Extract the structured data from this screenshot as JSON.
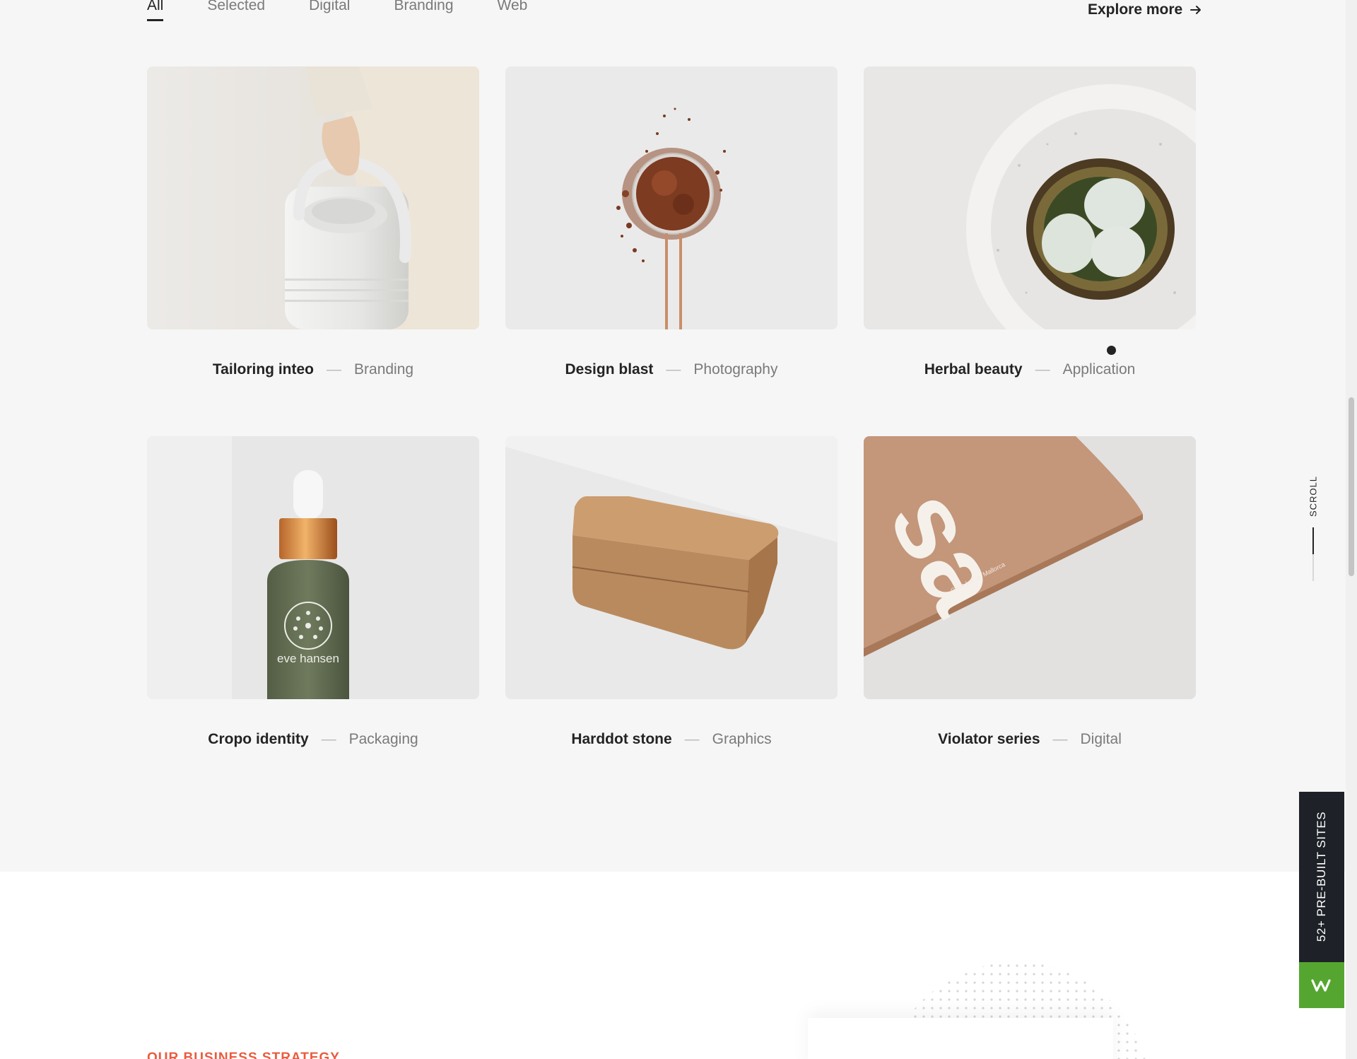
{
  "filters": {
    "items": [
      {
        "label": "All"
      },
      {
        "label": "Selected"
      },
      {
        "label": "Digital"
      },
      {
        "label": "Branding"
      },
      {
        "label": "Web"
      }
    ],
    "active": "All"
  },
  "explore": {
    "label": "Explore more",
    "icon": "arrow-right-icon"
  },
  "projects": [
    {
      "title": "Tailoring inteo",
      "separator": "—",
      "category": "Branding",
      "image": "white-kettle-photo"
    },
    {
      "title": "Design blast",
      "separator": "—",
      "category": "Photography",
      "image": "cocoa-spoon-photo"
    },
    {
      "title": "Herbal beauty",
      "separator": "—",
      "category": "Application",
      "image": "eggs-nest-photo"
    },
    {
      "title": "Cropo identity",
      "separator": "—",
      "category": "Packaging",
      "image": "dropper-bottle-photo"
    },
    {
      "title": "Harddot stone",
      "separator": "—",
      "category": "Graphics",
      "image": "cork-box-photo"
    },
    {
      "title": "Violator series",
      "separator": "—",
      "category": "Digital",
      "image": "book-cover-photo"
    }
  ],
  "image_text": {
    "bottle_brand": "eve hansen",
    "book_cover": "sa",
    "book_spine": "Casa Lama, Mallorca"
  },
  "scroll": {
    "label": "SCROLL"
  },
  "badge": {
    "label": "52+ PRE-BUILT SITES",
    "logo_icon": "w-logo-icon"
  },
  "section": {
    "eyebrow": "OUR BUSINESS STRATEGY"
  },
  "colors": {
    "background": "#f6f6f6",
    "text": "#232323",
    "muted": "#7a7a7a",
    "accent": "#e85c3f",
    "badge_dark": "#1e2128",
    "badge_green": "#55a630"
  }
}
